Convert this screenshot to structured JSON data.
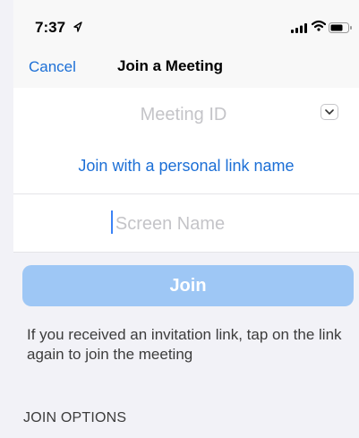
{
  "status_bar": {
    "time": "7:37"
  },
  "nav": {
    "cancel_label": "Cancel",
    "title": "Join a Meeting"
  },
  "form": {
    "meeting_id_placeholder": "Meeting ID",
    "personal_link_label": "Join with a personal link name",
    "screen_name_placeholder": "Screen Name",
    "join_label": "Join"
  },
  "hint_text": "If you received an invitation link, tap on the link again to join the meeting",
  "section": {
    "join_options_label": "JOIN OPTIONS"
  },
  "colors": {
    "accent": "#1c6fd6",
    "join_button_disabled": "#9ec7f5",
    "caret": "#3b82f6"
  },
  "icons": [
    "location-arrow-icon",
    "signal-icon",
    "wifi-icon",
    "battery-icon",
    "chevron-down-icon"
  ]
}
